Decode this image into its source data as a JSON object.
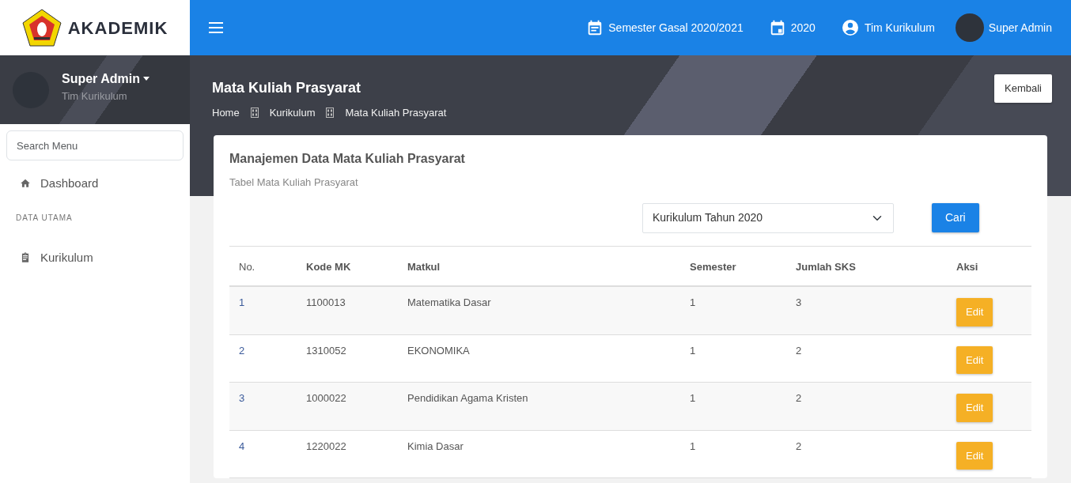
{
  "brand": {
    "title": "AKADEMIK"
  },
  "topbar": {
    "items": [
      {
        "kind": "semester",
        "label": "Semester Gasal 2020/2021"
      },
      {
        "kind": "year",
        "label": "2020"
      },
      {
        "kind": "account",
        "label": "Tim Kurikulum"
      },
      {
        "kind": "avatar",
        "label": "Super Admin"
      }
    ]
  },
  "user_panel": {
    "name": "Super Admin",
    "role": "Tim Kurikulum"
  },
  "sidebar": {
    "search": {
      "placeholder": "Search Menu"
    },
    "items": [
      {
        "kind": "link",
        "label": "Dashboard"
      },
      {
        "kind": "heading",
        "label": "DATA UTAMA"
      },
      {
        "kind": "link",
        "label": "Kurikulum"
      }
    ]
  },
  "page_header": {
    "title": "Mata Kuliah Prasyarat",
    "breadcrumb": [
      "Home",
      "Kurikulum",
      "Mata Kuliah Prasyarat"
    ],
    "back_button": "Kembali"
  },
  "card": {
    "title": "Manajemen Data Mata Kuliah Prasyarat",
    "subtitle": "Tabel Mata Kuliah Prasyarat",
    "filter": {
      "value": "Kurikulum Tahun 2020"
    },
    "search_button": "Cari",
    "table": {
      "columns": [
        "No.",
        "Kode MK",
        "Matkul",
        "Semester",
        "Jumlah SKS",
        "Aksi"
      ],
      "rows": [
        {
          "no": "1",
          "code": "1100013",
          "course": "Matematika Dasar",
          "semester": "1",
          "sks": "3",
          "action": "Edit"
        },
        {
          "no": "2",
          "code": "1310052",
          "course": "EKONOMIKA",
          "semester": "1",
          "sks": "2",
          "action": "Edit"
        },
        {
          "no": "3",
          "code": "1000022",
          "course": "Pendidikan Agama Kristen",
          "semester": "1",
          "sks": "2",
          "action": "Edit"
        },
        {
          "no": "4",
          "code": "1220022",
          "course": "Kimia Dasar",
          "semester": "1",
          "sks": "2",
          "action": "Edit"
        }
      ]
    }
  }
}
